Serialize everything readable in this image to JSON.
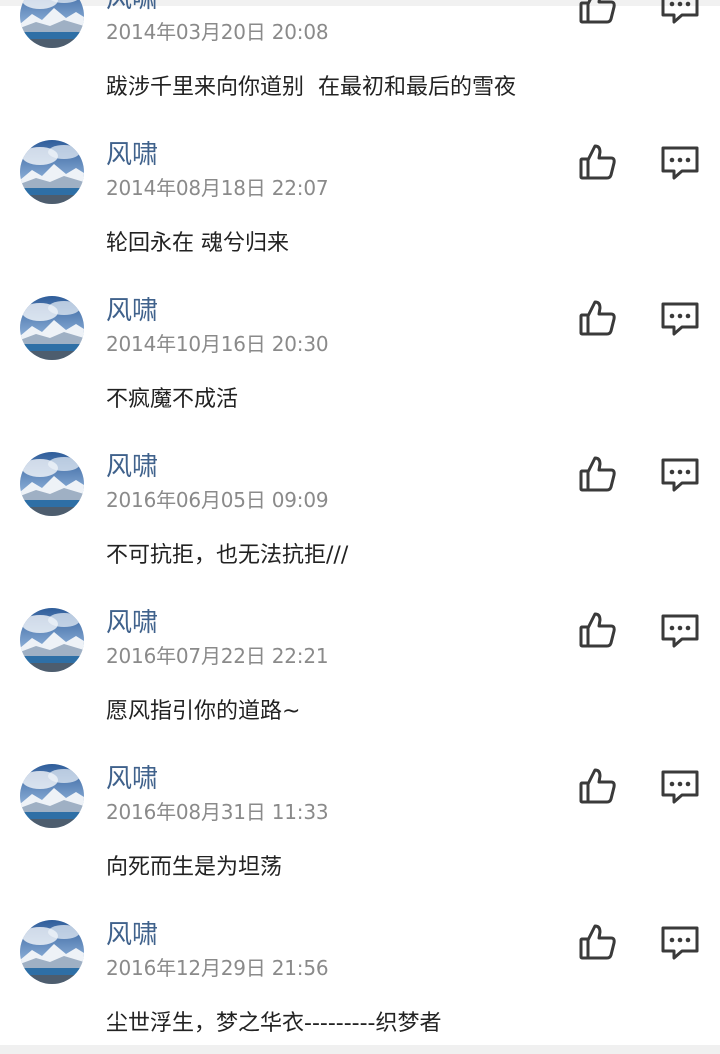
{
  "comments": [
    {
      "author": "风啸",
      "time": "2014年03月20日 20:08",
      "text": "跋涉千里来向你道别  在最初和最后的雪夜"
    },
    {
      "author": "风啸",
      "time": "2014年08月18日 22:07",
      "text": "轮回永在 魂兮归来"
    },
    {
      "author": "风啸",
      "time": "2014年10月16日 20:30",
      "text": "不疯魔不成活"
    },
    {
      "author": "风啸",
      "time": "2016年06月05日 09:09",
      "text": "不可抗拒，也无法抗拒///"
    },
    {
      "author": "风啸",
      "time": "2016年07月22日 22:21",
      "text": "愿风指引你的道路~"
    },
    {
      "author": "风啸",
      "time": "2016年08月31日 11:33",
      "text": "向死而生是为坦荡"
    },
    {
      "author": "风啸",
      "time": "2016年12月29日 21:56",
      "text": "尘世浮生，梦之华衣---------织梦者"
    }
  ],
  "icons": {
    "like": "thumbs-up-icon",
    "reply": "comment-icon"
  },
  "colors": {
    "author": "#40628c",
    "time": "#8a8a8a",
    "text": "#222222",
    "icon": "#3a3a3a"
  }
}
